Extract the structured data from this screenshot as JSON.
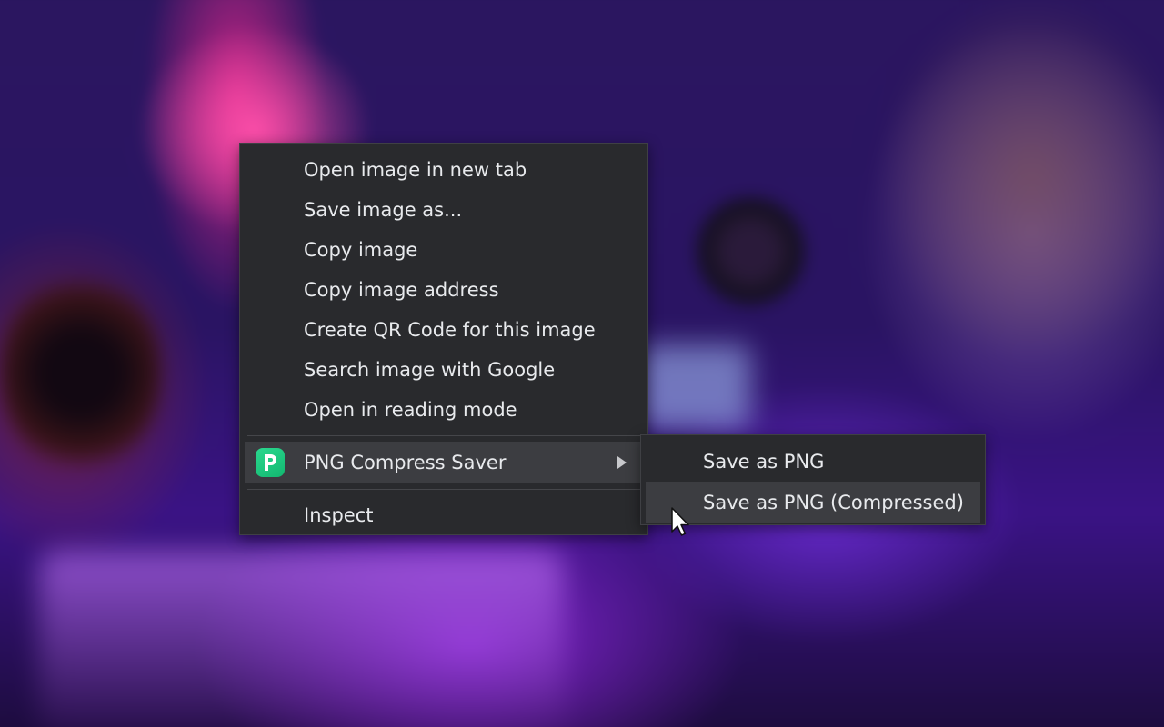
{
  "context_menu": {
    "items": [
      {
        "label": "Open image in new tab"
      },
      {
        "label": "Save image as..."
      },
      {
        "label": "Copy image"
      },
      {
        "label": "Copy image address"
      },
      {
        "label": "Create QR Code for this image"
      },
      {
        "label": "Search image with Google"
      },
      {
        "label": "Open in reading mode"
      }
    ],
    "extension_item": {
      "label": "PNG Compress Saver",
      "icon": "png-compress-saver-icon"
    },
    "inspect_label": "Inspect"
  },
  "submenu": {
    "items": [
      {
        "label": "Save as PNG"
      },
      {
        "label": "Save as PNG (Compressed)"
      }
    ]
  },
  "colors": {
    "menu_bg": "#292a2d",
    "hover_bg": "#3c3d41",
    "text": "#e8eaed",
    "icon_green": "#1fc97e"
  }
}
